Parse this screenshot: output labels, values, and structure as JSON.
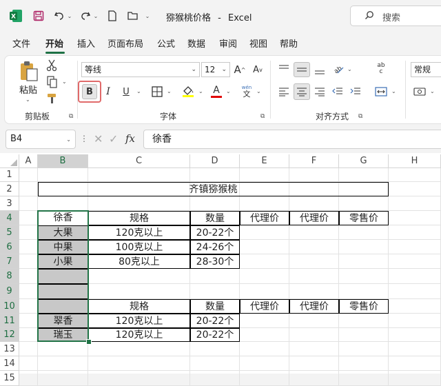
{
  "titlebar": {
    "filename": "猕猴桃价格",
    "separator": "-",
    "app": "Excel",
    "search_placeholder": "搜索"
  },
  "menu": [
    "文件",
    "开始",
    "插入",
    "页面布局",
    "公式",
    "数据",
    "审阅",
    "视图",
    "帮助"
  ],
  "ribbon": {
    "paste_label": "粘贴",
    "clipboard_group": "剪贴板",
    "font_name": "等线",
    "font_size": "12",
    "grow_font": "A",
    "shrink_font": "A",
    "bold": "B",
    "italic": "I",
    "underline": "U",
    "font_color_glyph": "A",
    "phonetic_top": "wén",
    "phonetic_bottom": "文",
    "font_group": "字体",
    "alignment_group": "对齐方式",
    "number_format": "常规",
    "wrap_glyph": "ab",
    "wrap_glyph2": "c"
  },
  "formula_bar": {
    "name_box": "B4",
    "fx": "fx",
    "content": "徐香"
  },
  "columns": [
    "A",
    "B",
    "C",
    "D",
    "E",
    "F",
    "G",
    "H"
  ],
  "rows": [
    "1",
    "2",
    "3",
    "4",
    "5",
    "6",
    "7",
    "8",
    "9",
    "10",
    "11",
    "12",
    "13",
    "14",
    "15"
  ],
  "cells": {
    "title": "齐镇猕猴桃",
    "r4": [
      "徐香",
      "规格",
      "数量",
      "代理价",
      "代理价",
      "零售价"
    ],
    "r5": [
      "大果",
      "120克以上",
      "20-22个"
    ],
    "r6": [
      "中果",
      "100克以上",
      "24-26个"
    ],
    "r7": [
      "小果",
      "80克以上",
      "28-30个"
    ],
    "r10": [
      "规格",
      "数量",
      "代理价",
      "代理价",
      "零售价"
    ],
    "r11": [
      "翠香",
      "120克以上",
      "20-22个"
    ],
    "r12": [
      "瑞玉",
      "120克以上",
      "20-22个"
    ]
  },
  "colors": {
    "excel_green": "#1e7145",
    "selection_green": "#217346",
    "gray_fill": "#c8c8c8",
    "font_color_bar": "#e00000",
    "highlight_bar": "#ffff00"
  }
}
